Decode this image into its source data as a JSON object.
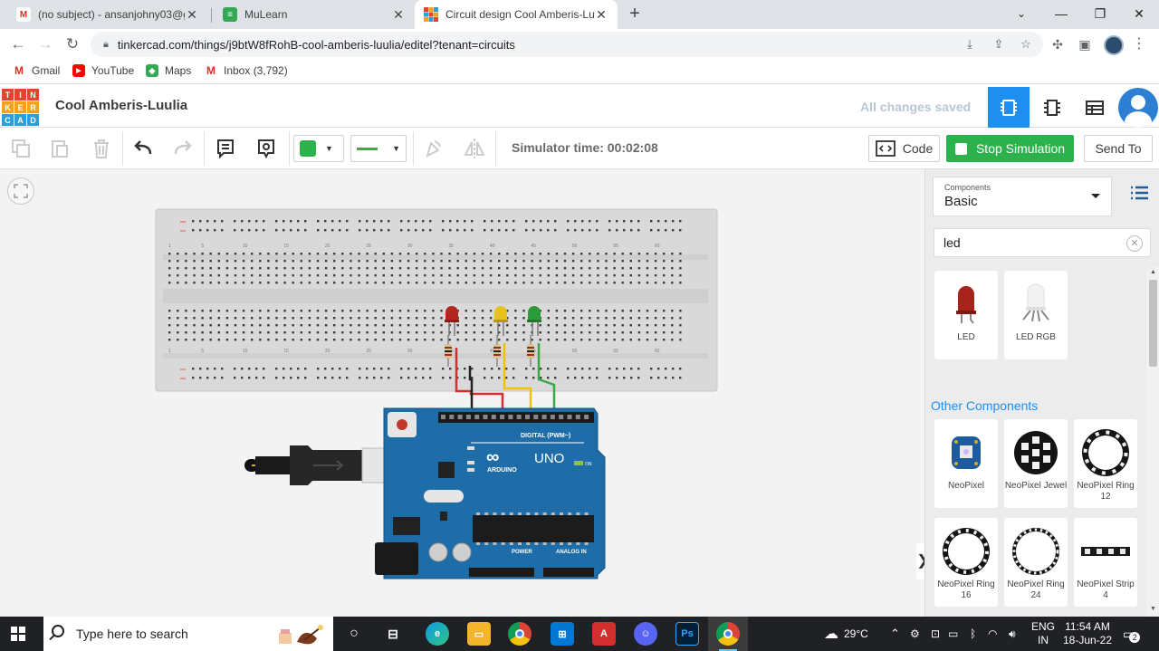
{
  "browser": {
    "tabs": [
      {
        "title": "(no subject) - ansanjohny03@gm",
        "favicon": "gmail-icon"
      },
      {
        "title": "MuLearn",
        "favicon": "mulearn-icon"
      },
      {
        "title": "Circuit design Cool Amberis-Luul",
        "favicon": "tinkercad-icon"
      }
    ],
    "url": "tinkercad.com/things/j9btW8fRohB-cool-amberis-luulia/editel?tenant=circuits",
    "bookmarks": [
      {
        "label": "Gmail",
        "icon": "gmail-icon"
      },
      {
        "label": "YouTube",
        "icon": "youtube-icon"
      },
      {
        "label": "Maps",
        "icon": "maps-icon"
      },
      {
        "label": "Inbox (3,792)",
        "icon": "gmail-icon"
      }
    ]
  },
  "header": {
    "logo_letters": [
      "T",
      "I",
      "N",
      "K",
      "E",
      "R",
      "C",
      "A",
      "D"
    ],
    "design_name": "Cool Amberis-Luulia",
    "save_status": "All changes saved"
  },
  "toolbar": {
    "sim_time": "Simulator time: 00:02:08",
    "code_label": "Code",
    "stop_label": "Stop Simulation",
    "send_label": "Send To",
    "fill_color": "#2bb24c",
    "accent": "#1f8ef1"
  },
  "panel": {
    "components_label": "Components",
    "components_value": "Basic",
    "search_value": "led",
    "basic_items": [
      {
        "name": "LED"
      },
      {
        "name": "LED RGB"
      }
    ],
    "other_title": "Other Components",
    "other_items": [
      {
        "name": "NeoPixel"
      },
      {
        "name": "NeoPixel Jewel"
      },
      {
        "name": "NeoPixel Ring 12"
      },
      {
        "name": "NeoPixel Ring 16"
      },
      {
        "name": "NeoPixel Ring 24"
      },
      {
        "name": "NeoPixel Strip 4"
      }
    ]
  },
  "board": {
    "digital_label": "DIGITAL (PWM~)",
    "brand": "ARDUINO",
    "model": "UNO",
    "on_label": "ON",
    "power_label": "POWER",
    "analog_label": "ANALOG IN",
    "led_colors": [
      "#b3261e",
      "#e8c21c",
      "#2d9b3a"
    ],
    "wire_colors": [
      "#d32f2f",
      "#f2c200",
      "#3aa845",
      "#222222"
    ],
    "column_numbers": [
      "1",
      "5",
      "10",
      "15",
      "20",
      "25",
      "30",
      "35",
      "40",
      "45",
      "50",
      "55",
      "60"
    ]
  },
  "taskbar": {
    "search_placeholder": "Type here to search",
    "weather": "29°C",
    "lang_1": "ENG",
    "lang_2": "IN",
    "time": "11:54 AM",
    "date": "18-Jun-22",
    "notifications": "2"
  }
}
